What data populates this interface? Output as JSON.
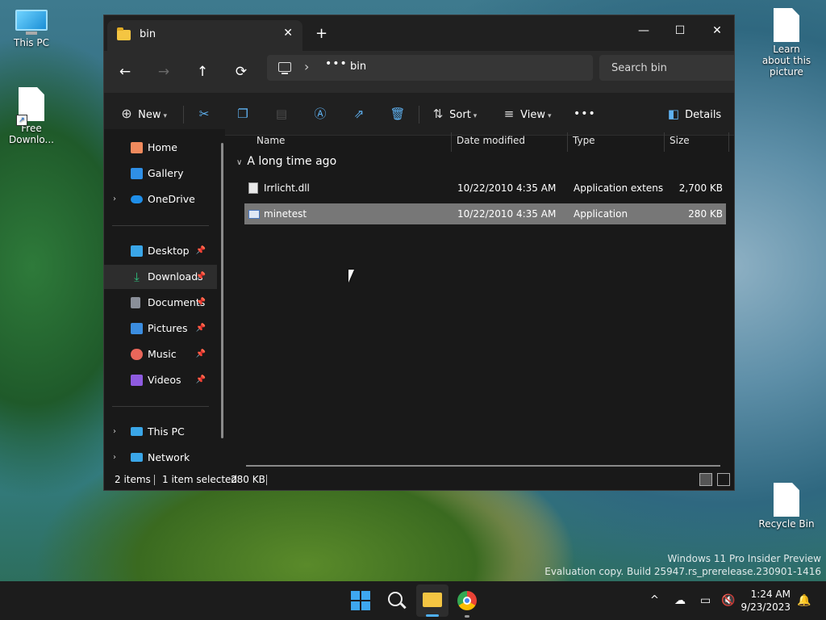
{
  "desktop": {
    "icons": [
      {
        "label": "This PC",
        "type": "monitor"
      },
      {
        "label": "Free Downlo...",
        "type": "shortcut"
      },
      {
        "label": "Learn about this picture",
        "type": "doc"
      },
      {
        "label": "Recycle Bin",
        "type": "doc"
      }
    ],
    "watermark_line1": "Windows 11 Pro Insider Preview",
    "watermark_line2": "Evaluation copy. Build 25947.rs_prerelease.230901-1416"
  },
  "window": {
    "tab_title": "bin",
    "tab_close": "✕",
    "new_tab": "+",
    "minimize": "—",
    "maximize": "☐",
    "close": "✕"
  },
  "nav": {
    "back": "←",
    "forward": "→",
    "up": "↑",
    "refresh": "⟳",
    "more_crumbs": "•••",
    "crumb_sep": "›",
    "current_folder": "bin",
    "search_placeholder": "Search bin"
  },
  "toolbar": {
    "new_label": "New",
    "sort_label": "Sort",
    "view_label": "View",
    "more": "•••",
    "details_label": "Details",
    "icons": [
      "cut-icon",
      "copy-icon",
      "paste-icon",
      "rename-icon",
      "share-icon",
      "delete-icon"
    ]
  },
  "sidebar": {
    "top": [
      {
        "label": "Home",
        "icon": "home-icon",
        "color": "#f08a5d",
        "expandable": false
      },
      {
        "label": "Gallery",
        "icon": "gallery-icon",
        "color": "#2f8fe6",
        "expandable": false
      },
      {
        "label": "OneDrive",
        "icon": "cloud-icon",
        "color": "#1f8ee8",
        "expandable": true
      }
    ],
    "pinned": [
      {
        "label": "Desktop",
        "icon": "desktop-icon",
        "color": "#3aa6e8"
      },
      {
        "label": "Downloads",
        "icon": "download-icon",
        "color": "#2ec27e"
      },
      {
        "label": "Documents",
        "icon": "documents-icon",
        "color": "#8a8f99"
      },
      {
        "label": "Pictures",
        "icon": "pictures-icon",
        "color": "#3b8de0"
      },
      {
        "label": "Music",
        "icon": "music-icon",
        "color": "#e8665a"
      },
      {
        "label": "Videos",
        "icon": "videos-icon",
        "color": "#8e5be0"
      }
    ],
    "bottom": [
      {
        "label": "This PC",
        "icon": "pc-icon",
        "color": "#3aa6e8"
      },
      {
        "label": "Network",
        "icon": "network-icon",
        "color": "#3aa6e8"
      }
    ],
    "pin_glyph": "📌",
    "expand_glyph": "›"
  },
  "columns": {
    "name": "Name",
    "date": "Date modified",
    "type": "Type",
    "size": "Size"
  },
  "group": {
    "label": "A long time ago",
    "chevron": "∨"
  },
  "files": [
    {
      "name": "Irrlicht.dll",
      "date": "10/22/2010 4:35 AM",
      "type": "Application extens...",
      "size": "2,700 KB",
      "selected": false
    },
    {
      "name": "minetest",
      "date": "10/22/2010 4:35 AM",
      "type": "Application",
      "size": "280 KB",
      "selected": true
    }
  ],
  "status": {
    "items": "2 items",
    "selected": "1 item selected",
    "size": "280 KB"
  },
  "taskbar": {
    "time": "1:24 AM",
    "date": "9/23/2023",
    "tray_up": "^"
  }
}
